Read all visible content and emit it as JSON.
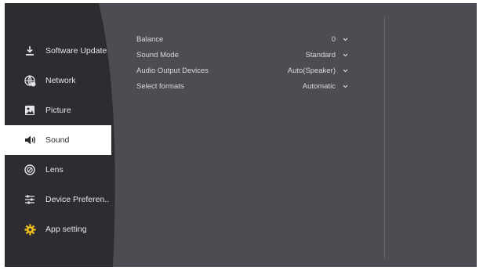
{
  "sidebar": {
    "items": [
      {
        "label": "Software Update",
        "icon": "download-icon",
        "active": false
      },
      {
        "label": "Network",
        "icon": "globe-settings-icon",
        "active": false
      },
      {
        "label": "Picture",
        "icon": "image-icon",
        "active": false
      },
      {
        "label": "Sound",
        "icon": "speaker-icon",
        "active": true
      },
      {
        "label": "Lens",
        "icon": "lens-icon",
        "active": false
      },
      {
        "label": "Device Preferen..",
        "icon": "sliders-icon",
        "active": false
      },
      {
        "label": "App setting",
        "icon": "gear-icon",
        "active": false
      }
    ]
  },
  "settings": {
    "rows": [
      {
        "label": "Balance",
        "value": "0"
      },
      {
        "label": "Sound Mode",
        "value": "Standard"
      },
      {
        "label": "Audio Output Devices",
        "value": "Auto(Speaker)"
      },
      {
        "label": "Select formats",
        "value": "Automatic"
      }
    ]
  },
  "colors": {
    "panel": "#4f4b52",
    "sidebar": "#2e2c30",
    "active_item": "#ffffff",
    "gear": "#f0c020"
  }
}
